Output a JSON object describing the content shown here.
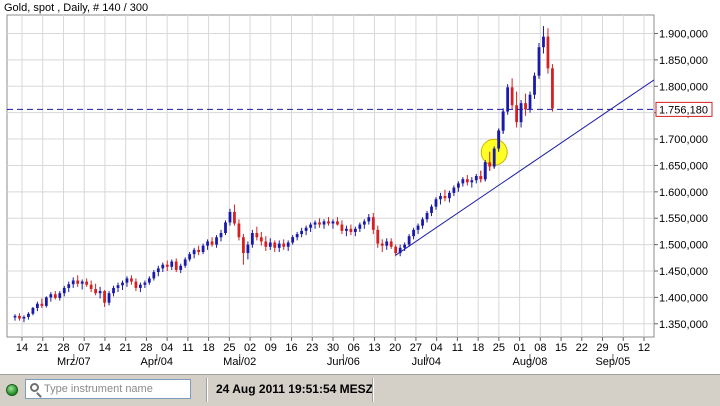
{
  "window_title": "Gold, spot , Daily, # 140 / 300",
  "toolbar": {
    "search_placeholder": "Type instrument name",
    "timestamp": "24 Aug 2011 19:51:54 MESZ"
  },
  "colors": {
    "up_candle": "#1a1aa8",
    "down_candle": "#d42020",
    "grid": "#d8d8d8",
    "trendline": "#1a1aa8",
    "highlight": "#ffff00"
  },
  "chart_data": {
    "type": "candlestick",
    "title": "Gold, spot , Daily, # 140 / 300",
    "ylim": [
      1325000,
      1935000
    ],
    "y_ticks": [
      "1.900,000",
      "1.850,000",
      "1.800,000",
      "1.750,000",
      "1.700,000",
      "1.650,000",
      "1.600,000",
      "1.550,000",
      "1.500,000",
      "1.450,000",
      "1.400,000",
      "1.350,000"
    ],
    "y_tick_values": [
      1900000,
      1850000,
      1800000,
      1750000,
      1700000,
      1650000,
      1600000,
      1550000,
      1500000,
      1450000,
      1400000,
      1350000
    ],
    "x_day_ticks": [
      "14",
      "21",
      "28",
      "07",
      "14",
      "21",
      "28",
      "04",
      "11",
      "18",
      "25",
      "02",
      "09",
      "16",
      "23",
      "30",
      "06",
      "13",
      "20",
      "27",
      "04",
      "11",
      "18",
      "25",
      "01",
      "08",
      "15",
      "22",
      "29",
      "05",
      "12"
    ],
    "x_month_labels": [
      "Mrz/07",
      "Apr/04",
      "Mai/02",
      "Jun/06",
      "Jul/04",
      "Aug/08",
      "Sep/05"
    ],
    "x_month_tick_index": [
      3,
      7,
      11,
      16,
      20,
      25,
      29
    ],
    "current_price": 1756180,
    "current_price_label": "1.756,180",
    "trendline": {
      "start": [
        "04 Jul",
        1480000
      ],
      "end": [
        "31 Aug",
        1812000
      ]
    },
    "highlight_circle": {
      "date": "08 Aug",
      "price": 1675000
    },
    "candles": [
      [
        1362000,
        1368000,
        1356000,
        1365000
      ],
      [
        1365000,
        1370000,
        1356000,
        1360000
      ],
      [
        1360000,
        1366000,
        1353000,
        1363000
      ],
      [
        1363000,
        1372000,
        1358000,
        1369000
      ],
      [
        1369000,
        1382000,
        1366000,
        1380000
      ],
      [
        1380000,
        1392000,
        1374000,
        1388000
      ],
      [
        1388000,
        1398000,
        1380000,
        1384000
      ],
      [
        1384000,
        1402000,
        1381000,
        1400000
      ],
      [
        1400000,
        1410000,
        1392000,
        1406000
      ],
      [
        1406000,
        1412000,
        1396000,
        1399000
      ],
      [
        1399000,
        1412000,
        1394000,
        1408000
      ],
      [
        1408000,
        1422000,
        1402000,
        1418000
      ],
      [
        1418000,
        1430000,
        1410000,
        1425000
      ],
      [
        1425000,
        1438000,
        1418000,
        1432000
      ],
      [
        1432000,
        1442000,
        1420000,
        1426000
      ],
      [
        1426000,
        1434000,
        1415000,
        1430000
      ],
      [
        1430000,
        1436000,
        1420000,
        1424000
      ],
      [
        1424000,
        1432000,
        1410000,
        1416000
      ],
      [
        1416000,
        1426000,
        1404000,
        1408000
      ],
      [
        1408000,
        1420000,
        1398000,
        1412000
      ],
      [
        1412000,
        1414000,
        1382000,
        1390000
      ],
      [
        1390000,
        1412000,
        1385000,
        1408000
      ],
      [
        1408000,
        1422000,
        1402000,
        1418000
      ],
      [
        1418000,
        1428000,
        1410000,
        1423000
      ],
      [
        1423000,
        1432000,
        1414000,
        1428000
      ],
      [
        1428000,
        1440000,
        1420000,
        1436000
      ],
      [
        1436000,
        1442000,
        1424000,
        1430000
      ],
      [
        1430000,
        1436000,
        1412000,
        1418000
      ],
      [
        1418000,
        1428000,
        1410000,
        1424000
      ],
      [
        1424000,
        1432000,
        1418000,
        1428000
      ],
      [
        1428000,
        1440000,
        1424000,
        1436000
      ],
      [
        1436000,
        1452000,
        1432000,
        1448000
      ],
      [
        1448000,
        1460000,
        1440000,
        1455000
      ],
      [
        1455000,
        1466000,
        1448000,
        1462000
      ],
      [
        1462000,
        1470000,
        1450000,
        1458000
      ],
      [
        1458000,
        1472000,
        1452000,
        1468000
      ],
      [
        1468000,
        1474000,
        1448000,
        1452000
      ],
      [
        1452000,
        1464000,
        1446000,
        1460000
      ],
      [
        1460000,
        1476000,
        1456000,
        1472000
      ],
      [
        1472000,
        1486000,
        1468000,
        1482000
      ],
      [
        1482000,
        1494000,
        1474000,
        1490000
      ],
      [
        1490000,
        1498000,
        1480000,
        1486000
      ],
      [
        1486000,
        1502000,
        1482000,
        1498000
      ],
      [
        1498000,
        1510000,
        1490000,
        1506000
      ],
      [
        1506000,
        1514000,
        1496000,
        1500000
      ],
      [
        1500000,
        1518000,
        1494000,
        1514000
      ],
      [
        1514000,
        1528000,
        1506000,
        1522000
      ],
      [
        1522000,
        1546000,
        1518000,
        1542000
      ],
      [
        1542000,
        1568000,
        1536000,
        1562000
      ],
      [
        1562000,
        1576000,
        1536000,
        1540000
      ],
      [
        1540000,
        1548000,
        1508000,
        1514000
      ],
      [
        1514000,
        1520000,
        1462000,
        1484000
      ],
      [
        1484000,
        1506000,
        1472000,
        1500000
      ],
      [
        1500000,
        1528000,
        1494000,
        1522000
      ],
      [
        1522000,
        1534000,
        1508000,
        1514000
      ],
      [
        1514000,
        1524000,
        1498000,
        1506000
      ],
      [
        1506000,
        1516000,
        1488000,
        1496000
      ],
      [
        1496000,
        1512000,
        1490000,
        1504000
      ],
      [
        1504000,
        1508000,
        1486000,
        1494000
      ],
      [
        1494000,
        1508000,
        1486000,
        1502000
      ],
      [
        1502000,
        1510000,
        1490000,
        1496000
      ],
      [
        1496000,
        1508000,
        1488000,
        1504000
      ],
      [
        1504000,
        1518000,
        1500000,
        1514000
      ],
      [
        1514000,
        1524000,
        1508000,
        1520000
      ],
      [
        1520000,
        1532000,
        1514000,
        1526000
      ],
      [
        1526000,
        1536000,
        1518000,
        1532000
      ],
      [
        1532000,
        1542000,
        1524000,
        1538000
      ],
      [
        1538000,
        1546000,
        1530000,
        1542000
      ],
      [
        1542000,
        1550000,
        1532000,
        1538000
      ],
      [
        1538000,
        1548000,
        1530000,
        1544000
      ],
      [
        1544000,
        1552000,
        1536000,
        1540000
      ],
      [
        1540000,
        1548000,
        1530000,
        1544000
      ],
      [
        1544000,
        1552000,
        1536000,
        1538000
      ],
      [
        1538000,
        1546000,
        1520000,
        1526000
      ],
      [
        1526000,
        1536000,
        1516000,
        1530000
      ],
      [
        1530000,
        1538000,
        1518000,
        1524000
      ],
      [
        1524000,
        1534000,
        1516000,
        1530000
      ],
      [
        1530000,
        1542000,
        1524000,
        1538000
      ],
      [
        1538000,
        1548000,
        1530000,
        1544000
      ],
      [
        1544000,
        1558000,
        1538000,
        1552000
      ],
      [
        1552000,
        1560000,
        1520000,
        1528000
      ],
      [
        1528000,
        1536000,
        1494000,
        1502000
      ],
      [
        1502000,
        1510000,
        1486000,
        1498000
      ],
      [
        1498000,
        1512000,
        1490000,
        1506000
      ],
      [
        1506000,
        1512000,
        1492000,
        1496000
      ],
      [
        1496000,
        1500000,
        1478000,
        1484000
      ],
      [
        1484000,
        1500000,
        1478000,
        1494000
      ],
      [
        1494000,
        1504000,
        1488000,
        1500000
      ],
      [
        1500000,
        1520000,
        1496000,
        1516000
      ],
      [
        1516000,
        1532000,
        1510000,
        1528000
      ],
      [
        1528000,
        1540000,
        1520000,
        1536000
      ],
      [
        1536000,
        1552000,
        1530000,
        1548000
      ],
      [
        1548000,
        1564000,
        1542000,
        1560000
      ],
      [
        1560000,
        1576000,
        1554000,
        1572000
      ],
      [
        1572000,
        1590000,
        1566000,
        1586000
      ],
      [
        1586000,
        1598000,
        1576000,
        1592000
      ],
      [
        1592000,
        1604000,
        1582000,
        1588000
      ],
      [
        1588000,
        1602000,
        1580000,
        1598000
      ],
      [
        1598000,
        1612000,
        1592000,
        1608000
      ],
      [
        1608000,
        1620000,
        1600000,
        1616000
      ],
      [
        1616000,
        1628000,
        1610000,
        1624000
      ],
      [
        1624000,
        1632000,
        1612000,
        1618000
      ],
      [
        1618000,
        1628000,
        1608000,
        1622000
      ],
      [
        1622000,
        1634000,
        1616000,
        1630000
      ],
      [
        1630000,
        1640000,
        1618000,
        1624000
      ],
      [
        1624000,
        1660000,
        1620000,
        1656000
      ],
      [
        1656000,
        1676000,
        1640000,
        1648000
      ],
      [
        1648000,
        1686000,
        1644000,
        1682000
      ],
      [
        1682000,
        1720000,
        1676000,
        1716000
      ],
      [
        1716000,
        1758000,
        1710000,
        1752000
      ],
      [
        1752000,
        1804000,
        1746000,
        1798000
      ],
      [
        1798000,
        1815000,
        1756000,
        1764000
      ],
      [
        1764000,
        1790000,
        1722000,
        1732000
      ],
      [
        1732000,
        1774000,
        1722000,
        1768000
      ],
      [
        1768000,
        1786000,
        1744000,
        1756000
      ],
      [
        1756000,
        1790000,
        1750000,
        1784000
      ],
      [
        1784000,
        1826000,
        1776000,
        1820000
      ],
      [
        1820000,
        1882000,
        1814000,
        1874000
      ],
      [
        1874000,
        1914000,
        1862000,
        1894000
      ],
      [
        1894000,
        1910000,
        1824000,
        1834000
      ],
      [
        1834000,
        1842000,
        1752000,
        1758000
      ]
    ]
  }
}
